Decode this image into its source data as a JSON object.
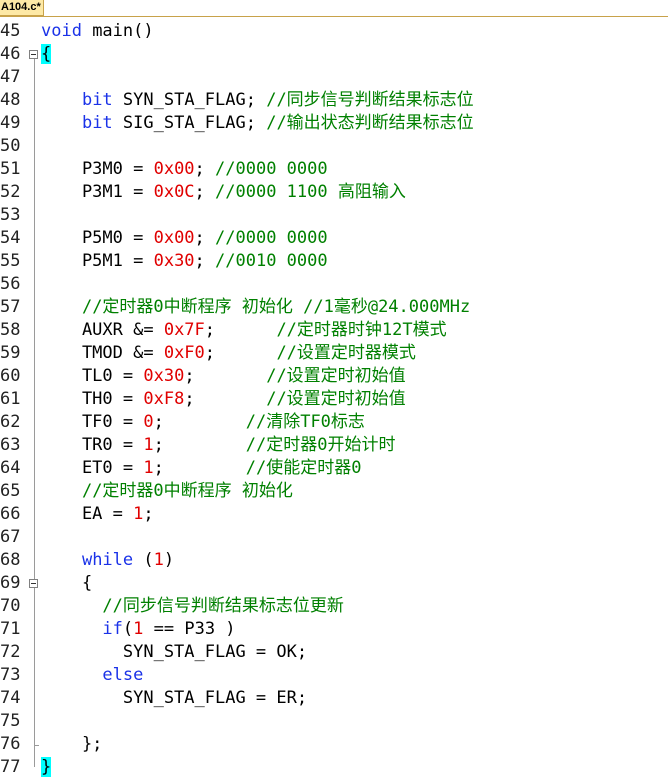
{
  "tab": {
    "label": "A104.c*"
  },
  "colors": {
    "keyword": "#1a32e8",
    "number": "#e00000",
    "comment": "#008000",
    "brace_highlight": "#00ffff",
    "tab": "#fde9a6"
  },
  "lines": [
    {
      "num": "45",
      "tokens": [
        {
          "t": "kw",
          "v": "void"
        },
        {
          "t": "p",
          "v": " main()"
        }
      ]
    },
    {
      "num": "46",
      "fold": true,
      "tokens": [
        {
          "t": "hl",
          "v": "{"
        }
      ]
    },
    {
      "num": "47",
      "tokens": []
    },
    {
      "num": "48",
      "tokens": [
        {
          "t": "p",
          "v": "    "
        },
        {
          "t": "kw",
          "v": "bit"
        },
        {
          "t": "p",
          "v": " SYN_STA_FLAG; "
        },
        {
          "t": "cm",
          "v": "//同步信号判断结果标志位"
        }
      ]
    },
    {
      "num": "49",
      "tokens": [
        {
          "t": "p",
          "v": "    "
        },
        {
          "t": "kw",
          "v": "bit"
        },
        {
          "t": "p",
          "v": " SIG_STA_FLAG; "
        },
        {
          "t": "cm",
          "v": "//输出状态判断结果标志位"
        }
      ]
    },
    {
      "num": "50",
      "tokens": []
    },
    {
      "num": "51",
      "tokens": [
        {
          "t": "p",
          "v": "    P3M0 = "
        },
        {
          "t": "num",
          "v": "0x00"
        },
        {
          "t": "p",
          "v": "; "
        },
        {
          "t": "cm",
          "v": "//0000 0000"
        }
      ]
    },
    {
      "num": "52",
      "tokens": [
        {
          "t": "p",
          "v": "    P3M1 = "
        },
        {
          "t": "num",
          "v": "0x0C"
        },
        {
          "t": "p",
          "v": "; "
        },
        {
          "t": "cm",
          "v": "//0000 1100 高阻输入"
        }
      ]
    },
    {
      "num": "53",
      "tokens": []
    },
    {
      "num": "54",
      "tokens": [
        {
          "t": "p",
          "v": "    P5M0 = "
        },
        {
          "t": "num",
          "v": "0x00"
        },
        {
          "t": "p",
          "v": "; "
        },
        {
          "t": "cm",
          "v": "//0000 0000"
        }
      ]
    },
    {
      "num": "55",
      "tokens": [
        {
          "t": "p",
          "v": "    P5M1 = "
        },
        {
          "t": "num",
          "v": "0x30"
        },
        {
          "t": "p",
          "v": "; "
        },
        {
          "t": "cm",
          "v": "//0010 0000"
        }
      ]
    },
    {
      "num": "56",
      "tokens": []
    },
    {
      "num": "57",
      "tokens": [
        {
          "t": "p",
          "v": "    "
        },
        {
          "t": "cm",
          "v": "//定时器0中断程序 初始化 //1毫秒@24.000MHz"
        }
      ]
    },
    {
      "num": "58",
      "tokens": [
        {
          "t": "p",
          "v": "    AUXR &= "
        },
        {
          "t": "num",
          "v": "0x7F"
        },
        {
          "t": "p",
          "v": ";      "
        },
        {
          "t": "cm",
          "v": "//定时器时钟12T模式"
        }
      ]
    },
    {
      "num": "59",
      "tokens": [
        {
          "t": "p",
          "v": "    TMOD &= "
        },
        {
          "t": "num",
          "v": "0xF0"
        },
        {
          "t": "p",
          "v": ";      "
        },
        {
          "t": "cm",
          "v": "//设置定时器模式"
        }
      ]
    },
    {
      "num": "60",
      "tokens": [
        {
          "t": "p",
          "v": "    TL0 = "
        },
        {
          "t": "num",
          "v": "0x30"
        },
        {
          "t": "p",
          "v": ";       "
        },
        {
          "t": "cm",
          "v": "//设置定时初始值"
        }
      ]
    },
    {
      "num": "61",
      "tokens": [
        {
          "t": "p",
          "v": "    TH0 = "
        },
        {
          "t": "num",
          "v": "0xF8"
        },
        {
          "t": "p",
          "v": ";       "
        },
        {
          "t": "cm",
          "v": "//设置定时初始值"
        }
      ]
    },
    {
      "num": "62",
      "tokens": [
        {
          "t": "p",
          "v": "    TF0 = "
        },
        {
          "t": "num",
          "v": "0"
        },
        {
          "t": "p",
          "v": ";        "
        },
        {
          "t": "cm",
          "v": "//清除TF0标志"
        }
      ]
    },
    {
      "num": "63",
      "tokens": [
        {
          "t": "p",
          "v": "    TR0 = "
        },
        {
          "t": "num",
          "v": "1"
        },
        {
          "t": "p",
          "v": ";        "
        },
        {
          "t": "cm",
          "v": "//定时器0开始计时"
        }
      ]
    },
    {
      "num": "64",
      "tokens": [
        {
          "t": "p",
          "v": "    ET0 = "
        },
        {
          "t": "num",
          "v": "1"
        },
        {
          "t": "p",
          "v": ";        "
        },
        {
          "t": "cm",
          "v": "//使能定时器0"
        }
      ]
    },
    {
      "num": "65",
      "tokens": [
        {
          "t": "p",
          "v": "    "
        },
        {
          "t": "cm",
          "v": "//定时器0中断程序 初始化"
        }
      ]
    },
    {
      "num": "66",
      "tokens": [
        {
          "t": "p",
          "v": "    EA = "
        },
        {
          "t": "num",
          "v": "1"
        },
        {
          "t": "p",
          "v": ";"
        }
      ]
    },
    {
      "num": "67",
      "tokens": []
    },
    {
      "num": "68",
      "tokens": [
        {
          "t": "p",
          "v": "    "
        },
        {
          "t": "kw",
          "v": "while"
        },
        {
          "t": "p",
          "v": " ("
        },
        {
          "t": "num",
          "v": "1"
        },
        {
          "t": "p",
          "v": ")"
        }
      ]
    },
    {
      "num": "69",
      "fold": true,
      "tokens": [
        {
          "t": "p",
          "v": "    {"
        }
      ]
    },
    {
      "num": "70",
      "tokens": [
        {
          "t": "p",
          "v": "      "
        },
        {
          "t": "cm",
          "v": "//同步信号判断结果标志位更新"
        }
      ]
    },
    {
      "num": "71",
      "tokens": [
        {
          "t": "p",
          "v": "      "
        },
        {
          "t": "kw",
          "v": "if"
        },
        {
          "t": "p",
          "v": "("
        },
        {
          "t": "num",
          "v": "1"
        },
        {
          "t": "p",
          "v": " == P33 )"
        }
      ]
    },
    {
      "num": "72",
      "tokens": [
        {
          "t": "p",
          "v": "        SYN_STA_FLAG = OK;"
        }
      ]
    },
    {
      "num": "73",
      "tokens": [
        {
          "t": "p",
          "v": "      "
        },
        {
          "t": "kw",
          "v": "else"
        }
      ]
    },
    {
      "num": "74",
      "tokens": [
        {
          "t": "p",
          "v": "        SYN_STA_FLAG = ER;"
        }
      ]
    },
    {
      "num": "75",
      "tokens": []
    },
    {
      "num": "76",
      "foldEnd": true,
      "tokens": [
        {
          "t": "p",
          "v": "    };"
        }
      ]
    },
    {
      "num": "77",
      "tokens": [
        {
          "t": "hl",
          "v": "}"
        }
      ]
    }
  ]
}
